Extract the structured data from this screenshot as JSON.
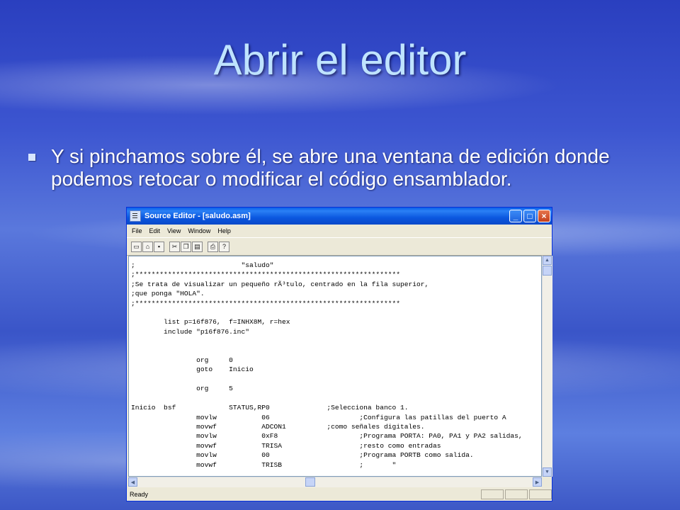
{
  "slide": {
    "title": "Abrir el editor",
    "bullet": "Y si pinchamos sobre él, se abre una ventana de edición donde podemos retocar o modificar el código ensamblador."
  },
  "window": {
    "title": "Source Editor - [saludo.asm]",
    "minimize": "_",
    "maximize": "□",
    "close": "×",
    "menu": [
      "File",
      "Edit",
      "View",
      "Window",
      "Help"
    ],
    "toolbar_icons": [
      "new-icon",
      "open-icon",
      "save-icon",
      "cut-icon",
      "copy-icon",
      "paste-icon",
      "print-icon",
      "help-icon"
    ],
    "status": "Ready",
    "code": ";                          \"saludo\"\n;*****************************************************************\n;Se trata de visualizar un pequeño rÃ³tulo, centrado en la fila superior,\n;que ponga \"HOLA\".\n;*****************************************************************\n\n        list p=16f876,  f=INHX8M, r=hex\n        include \"p16f876.inc\"\n\n\n                org     0\n                goto    Inicio\n\n                org     5\n\nInicio  bsf             STATUS,RP0              ;Selecciona banco 1.\n                movlw           06                      ;Configura las patillas del puerto A\n                movwf           ADCON1          ;como señales digitales.\n                movlw           0xF8                    ;Programa PORTA: PA0, PA1 y PA2 salidas,\n                movwf           TRISA                   ;resto como entradas\n                movlw           00                      ;Programa PORTB como salida.\n                movwf           TRISB                   ;       \"\n"
  }
}
